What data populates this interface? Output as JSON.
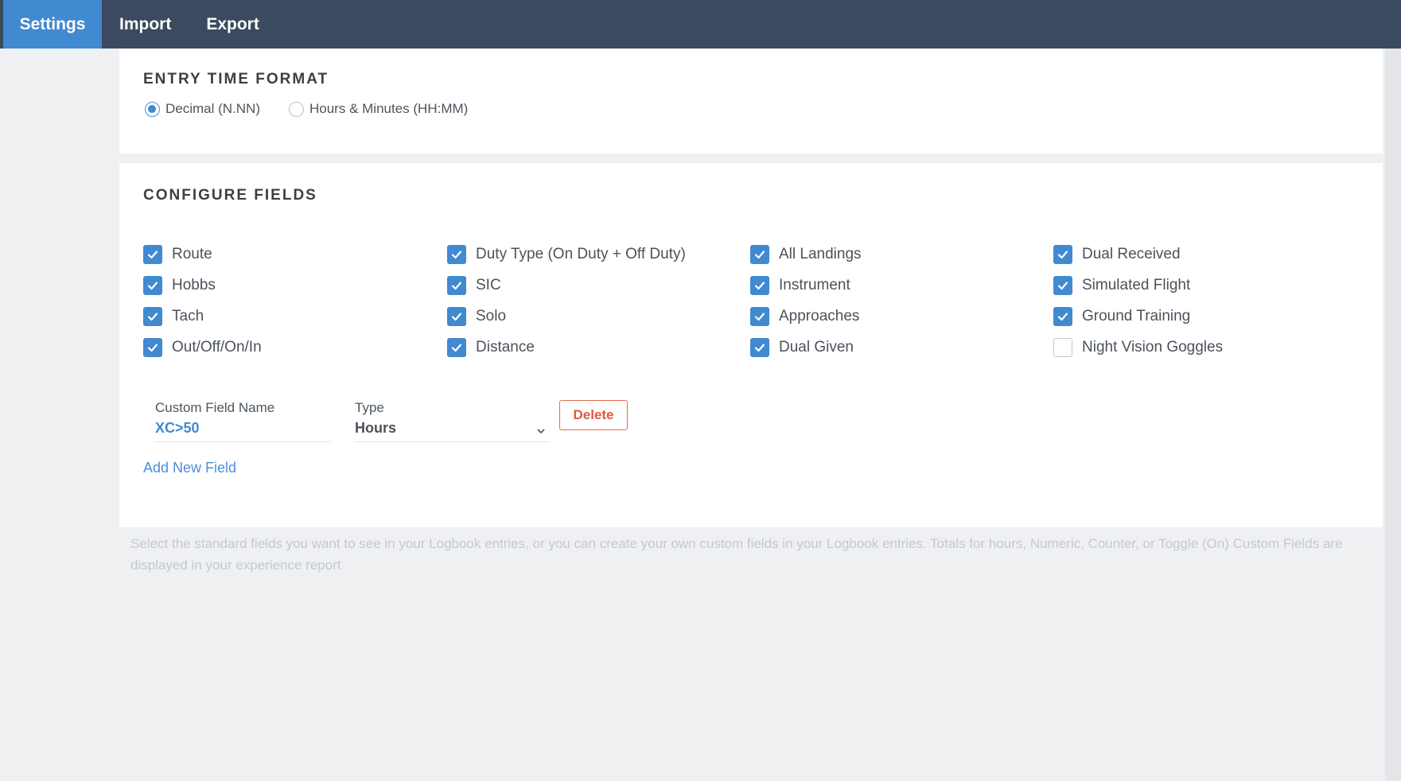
{
  "tabs": [
    {
      "label": "Settings",
      "active": true
    },
    {
      "label": "Import",
      "active": false
    },
    {
      "label": "Export",
      "active": false
    }
  ],
  "entry_time_format": {
    "title": "ENTRY TIME FORMAT",
    "options": [
      {
        "label": "Decimal (N.NN)",
        "selected": true
      },
      {
        "label": "Hours & Minutes (HH:MM)",
        "selected": false
      }
    ]
  },
  "configure_fields": {
    "title": "CONFIGURE FIELDS",
    "columns": [
      [
        {
          "label": "Route",
          "checked": true
        },
        {
          "label": "Hobbs",
          "checked": true
        },
        {
          "label": "Tach",
          "checked": true
        },
        {
          "label": "Out/Off/On/In",
          "checked": true
        }
      ],
      [
        {
          "label": "Duty Type (On Duty + Off Duty)",
          "checked": true
        },
        {
          "label": "SIC",
          "checked": true
        },
        {
          "label": "Solo",
          "checked": true
        },
        {
          "label": "Distance",
          "checked": true
        }
      ],
      [
        {
          "label": "All Landings",
          "checked": true
        },
        {
          "label": "Instrument",
          "checked": true
        },
        {
          "label": "Approaches",
          "checked": true
        },
        {
          "label": "Dual Given",
          "checked": true
        }
      ],
      [
        {
          "label": "Dual Received",
          "checked": true
        },
        {
          "label": "Simulated Flight",
          "checked": true
        },
        {
          "label": "Ground Training",
          "checked": true
        },
        {
          "label": "Night Vision Goggles",
          "checked": false
        }
      ]
    ],
    "custom_field": {
      "name_label": "Custom Field Name",
      "name_value": "XC>50",
      "type_label": "Type",
      "type_value": "Hours",
      "delete_label": "Delete"
    },
    "add_new_label": "Add New Field"
  },
  "help_text": "Select the standard fields you want to see in your Logbook entries, or you can create your own custom fields in your Logbook entries. Totals for hours, Numeric, Counter, or Toggle (On) Custom Fields are displayed in your experience report",
  "colors": {
    "topbar": "#3b4a5f",
    "accent": "#4189d1",
    "danger": "#e0583c"
  }
}
